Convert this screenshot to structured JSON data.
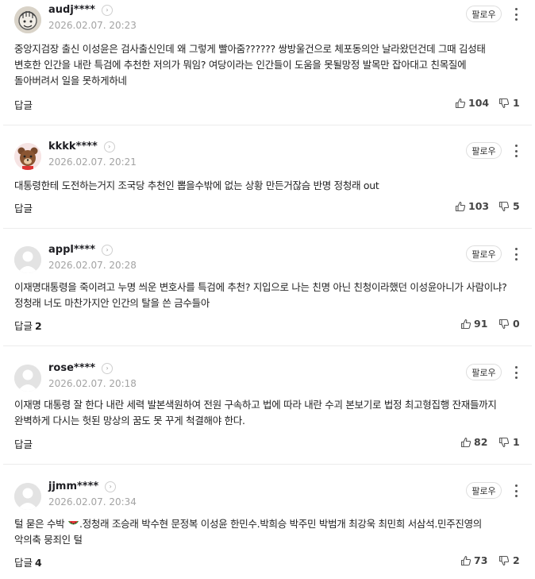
{
  "follow_label": "팔로우",
  "comments": [
    {
      "username": "audj****",
      "date": "2026.02.07. 20:23",
      "text": "중앙지검장 출신 이성윤은 검사출신인데 왜 그렇게 빨아줌?????? 쌍방울건으로 체포동의안 날라왔던건데 그때 김성태 변호한 인간을 내란 특검에 추천한 저의가 뭐임? 여당이라는 인간들이 도움을 못될망정 발목만 잡아대고 친목질에 돌아버려서 일을 못하게하네",
      "reply_label": "답글",
      "reply_count": "",
      "likes": "104",
      "dislikes": "1",
      "avatar": "cartoon-face"
    },
    {
      "username": "kkkk****",
      "date": "2026.02.07. 20:21",
      "text": "대통령한테 도전하는거지 조국당 추천인 뽑을수밖에 없는 상황 만든거잖슴 반명 정청래 out",
      "reply_label": "답글",
      "reply_count": "",
      "likes": "103",
      "dislikes": "5",
      "avatar": "bear"
    },
    {
      "username": "appl****",
      "date": "2026.02.07. 20:28",
      "text": "이재명대통령을 죽이려고 누명 씌운 변호사를 특검에 추천? 지입으로 나는 친명 아닌 친청이라했던 이성윤아니가 사람이냐? 정청래 너도 마찬가지안 인간의 탈을 쓴 금수들아",
      "reply_label": "답글",
      "reply_count": "2",
      "likes": "91",
      "dislikes": "0",
      "avatar": "default"
    },
    {
      "username": "rose****",
      "date": "2026.02.07. 20:18",
      "text": "이재명 대통령 잘 한다 내란 세력 발본색원하여 전원 구속하고 법에 따라 내란 수괴 본보기로 법정 최고형집행 잔재들까지 완벽하게 다시는 헛된 망상의 꿈도 못 꾸게 척결해야 한다.",
      "reply_label": "답글",
      "reply_count": "",
      "likes": "82",
      "dislikes": "1",
      "avatar": "default"
    },
    {
      "username": "jjmm****",
      "date": "2026.02.07. 20:34",
      "text_before": "털 묻은 수박 ",
      "text_after": ".정청래 조승래 박수현 문정복 이성윤 한민수.박희승 박주민 박범개 최강욱 최민희 서삼석.민주진영의 악의축 뭉죄인 털",
      "reply_label": "답글",
      "reply_count": "4",
      "likes": "73",
      "dislikes": "2",
      "avatar": "default"
    }
  ],
  "icons": {
    "like": "thumbs-up-icon",
    "dislike": "thumbs-down-icon",
    "more": "kebab-menu-icon",
    "profile": "chevron-right-icon",
    "emoji": "watermelon-emoji"
  }
}
